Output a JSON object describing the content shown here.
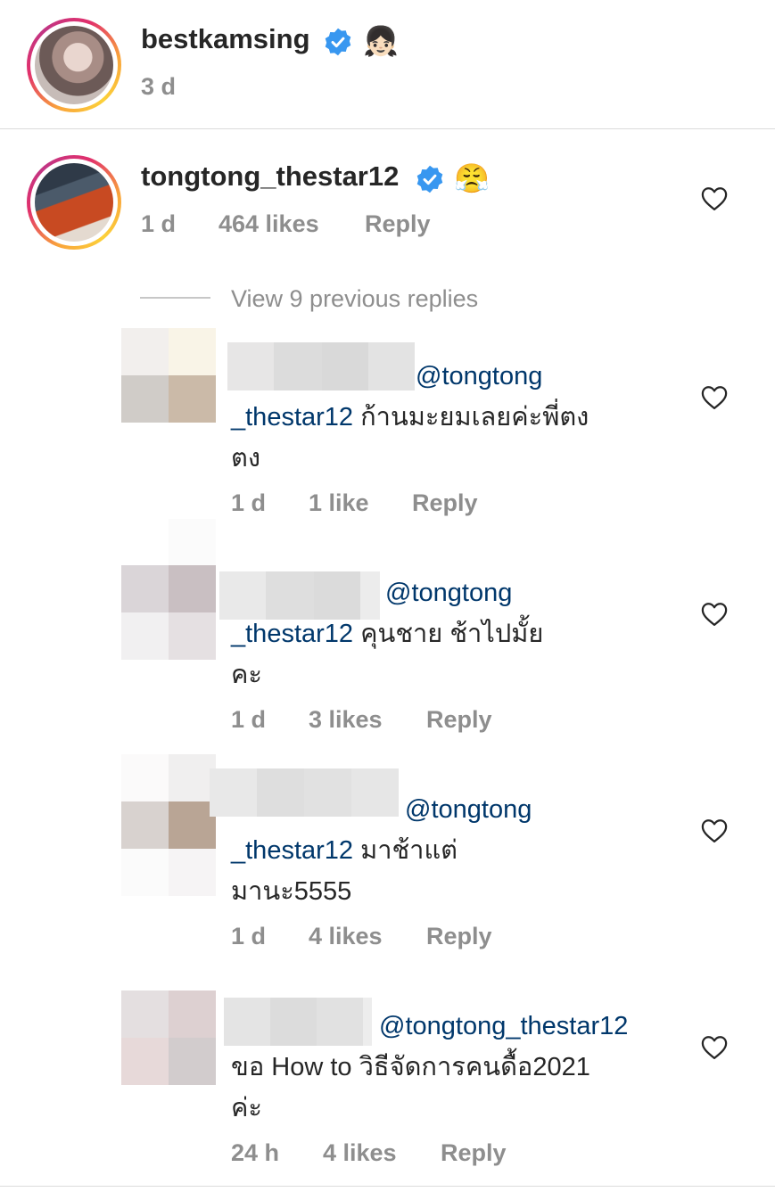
{
  "post_header": {
    "username": "bestkamsing",
    "emoji": "👧🏻",
    "time": "3 d"
  },
  "comment": {
    "username": "tongtong_thestar12",
    "emoji": "😤",
    "time": "1 d",
    "likes": "464 likes",
    "reply": "Reply"
  },
  "view_previous": "View 9 previous replies",
  "replies": [
    {
      "mention": "@tongtong",
      "line1_mention": "_thestar12",
      "line1_text": " ก้านมะยมเลยค่ะพี่ตง",
      "line2": "ตง",
      "time": "1 d",
      "likes": "1 like",
      "reply": "Reply"
    },
    {
      "mention": "@tongtong",
      "line1_mention": "_thestar12",
      "line1_text": " คุนชาย ช้าไปมั้ย",
      "line2": "คะ",
      "time": "1 d",
      "likes": "3 likes",
      "reply": "Reply"
    },
    {
      "mention": "@tongtong",
      "line1_mention": "_thestar12",
      "line1_text": " มาช้าแต่",
      "line2": "มานะ5555",
      "time": "1 d",
      "likes": "4 likes",
      "reply": "Reply"
    },
    {
      "mention": "@tongtong_thestar12",
      "line1_mention": "",
      "line1_text": "ขอ How to วิธีจัดการคนดื้อ2021",
      "line2": "ค่ะ",
      "time": "24 h",
      "likes": "4 likes",
      "reply": "Reply"
    }
  ],
  "colors": {
    "verified_blue": "#3897f0",
    "mention_blue": "#00376b",
    "meta_grey": "#8e8e8e",
    "divider": "#dbdbdb"
  },
  "icons": [
    "verified-badge-icon",
    "heart-outline-icon"
  ]
}
